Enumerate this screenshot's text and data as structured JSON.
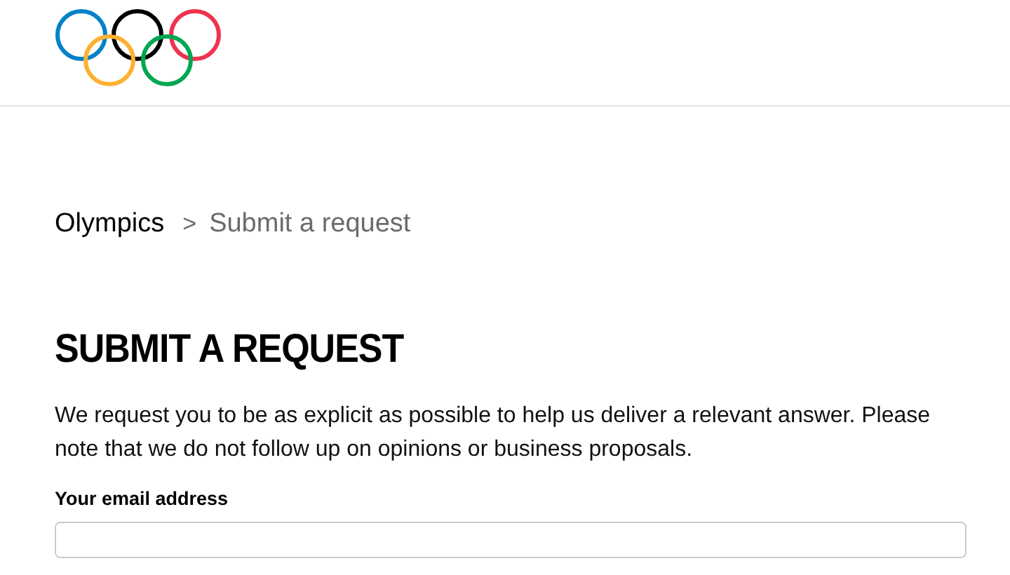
{
  "breadcrumb": {
    "separator": ">",
    "items": [
      {
        "label": "Olympics",
        "current": false
      },
      {
        "label": "Submit a request",
        "current": true
      }
    ]
  },
  "title": "SUBMIT A REQUEST",
  "intro": "We request you to be as explicit as possible to help us deliver a relevant answer. Please note that we do not follow up on opinions or business proposals.",
  "fields": [
    {
      "label": "Your email address"
    }
  ]
}
